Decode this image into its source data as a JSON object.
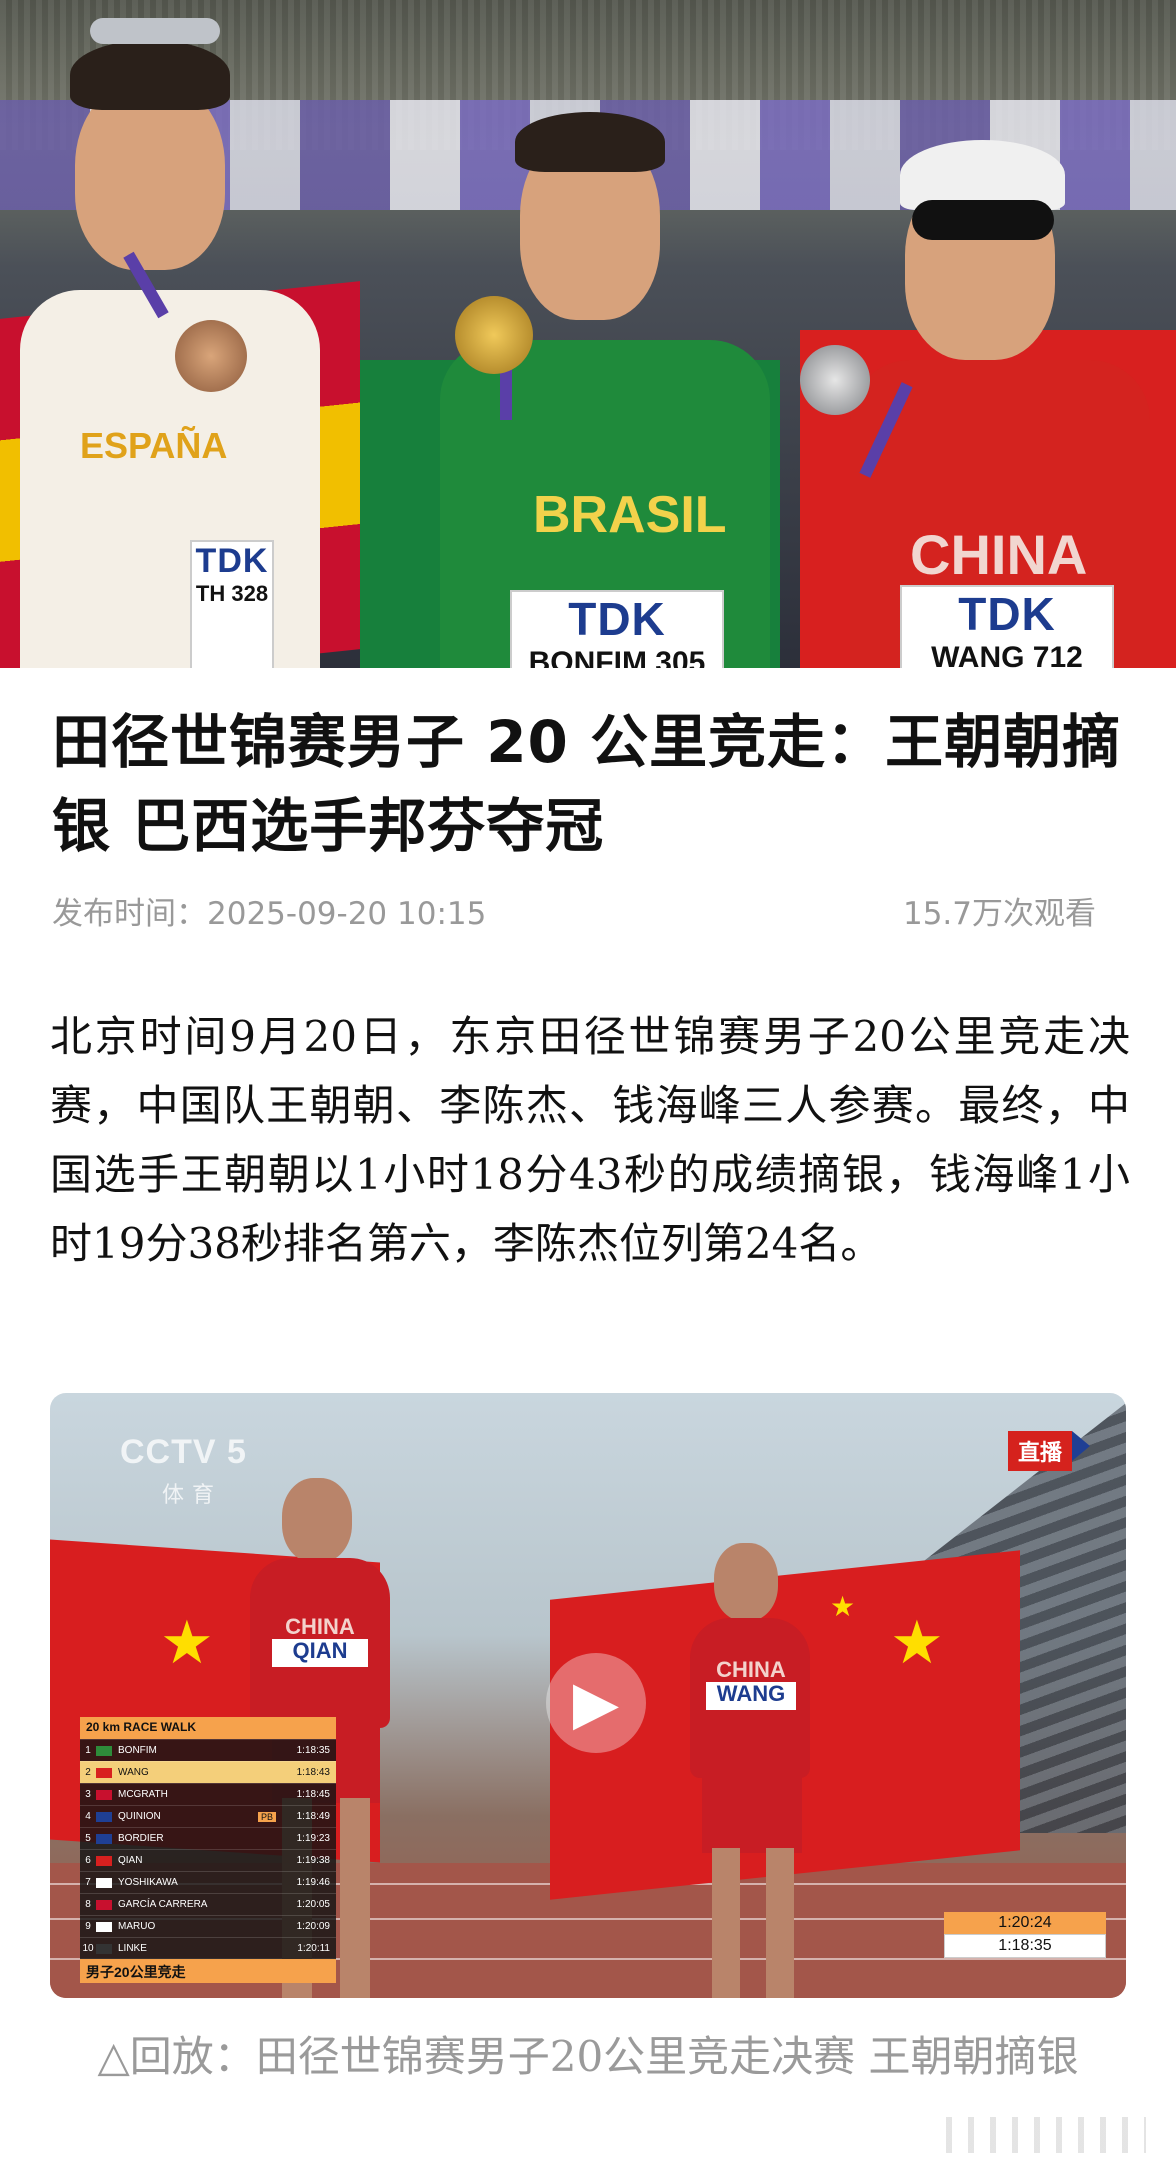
{
  "hero": {
    "athletes": [
      {
        "country_jersey": "ESPAÑA",
        "bib_brand": "TDK",
        "bib_name": "TH 328"
      },
      {
        "country_jersey": "BRASIL",
        "bib_brand": "TDK",
        "bib_name": "BONFIM 305"
      },
      {
        "country_jersey": "CHINA",
        "bib_brand": "TDK",
        "bib_name": "WANG 712"
      }
    ]
  },
  "article": {
    "title": "田径世锦赛男子 20 公里竞走：王朝朝摘银 巴西选手邦芬夺冠",
    "published_label": "发布时间：",
    "published_time": "2025-09-20 10:15",
    "views": "15.7万次观看",
    "body": "北京时间9月20日，东京田径世锦赛男子20公里竞走决赛，中国队王朝朝、李陈杰、钱海峰三人参赛。最终，中国选手王朝朝以1小时18分43秒的成绩摘银，钱海峰1小时19分38秒排名第六，李陈杰位列第24名。"
  },
  "video": {
    "channel_logo": "CCTV 5",
    "channel_sub": "体育",
    "live_badge": "直播",
    "runner_left_bib": "QIAN",
    "runner_left_country": "CHINA",
    "runner_right_bib": "WANG",
    "runner_right_country": "CHINA",
    "results_title": "20 km RACE WALK",
    "results": [
      {
        "pos": "1",
        "name": "BONFIM",
        "time": "1:18:35",
        "pb": ""
      },
      {
        "pos": "2",
        "name": "WANG",
        "time": "1:18:43",
        "pb": ""
      },
      {
        "pos": "3",
        "name": "MCGRATH",
        "time": "1:18:45",
        "pb": ""
      },
      {
        "pos": "4",
        "name": "QUINION",
        "time": "1:18:49",
        "pb": "PB"
      },
      {
        "pos": "5",
        "name": "BORDIER",
        "time": "1:19:23",
        "pb": ""
      },
      {
        "pos": "6",
        "name": "QIAN",
        "time": "1:19:38",
        "pb": ""
      },
      {
        "pos": "7",
        "name": "YOSHIKAWA",
        "time": "1:19:46",
        "pb": ""
      },
      {
        "pos": "8",
        "name": "GARCÍA CARRERA",
        "time": "1:20:05",
        "pb": ""
      },
      {
        "pos": "9",
        "name": "MARUO",
        "time": "1:20:09",
        "pb": ""
      },
      {
        "pos": "10",
        "name": "LINKE",
        "time": "1:20:11",
        "pb": ""
      }
    ],
    "results_footer": "男子20公里竞走",
    "timer_elapsed": "1:20:24",
    "timer_leader": "1:18:35"
  },
  "caption": "△回放：田径世锦赛男子20公里竞走决赛 王朝朝摘银",
  "colors": {
    "results_accent": "#f6a24c",
    "live_red": "#d5221d",
    "china_red": "#d8201f",
    "brazil_green": "#17803c",
    "meta_gray": "#999999"
  }
}
